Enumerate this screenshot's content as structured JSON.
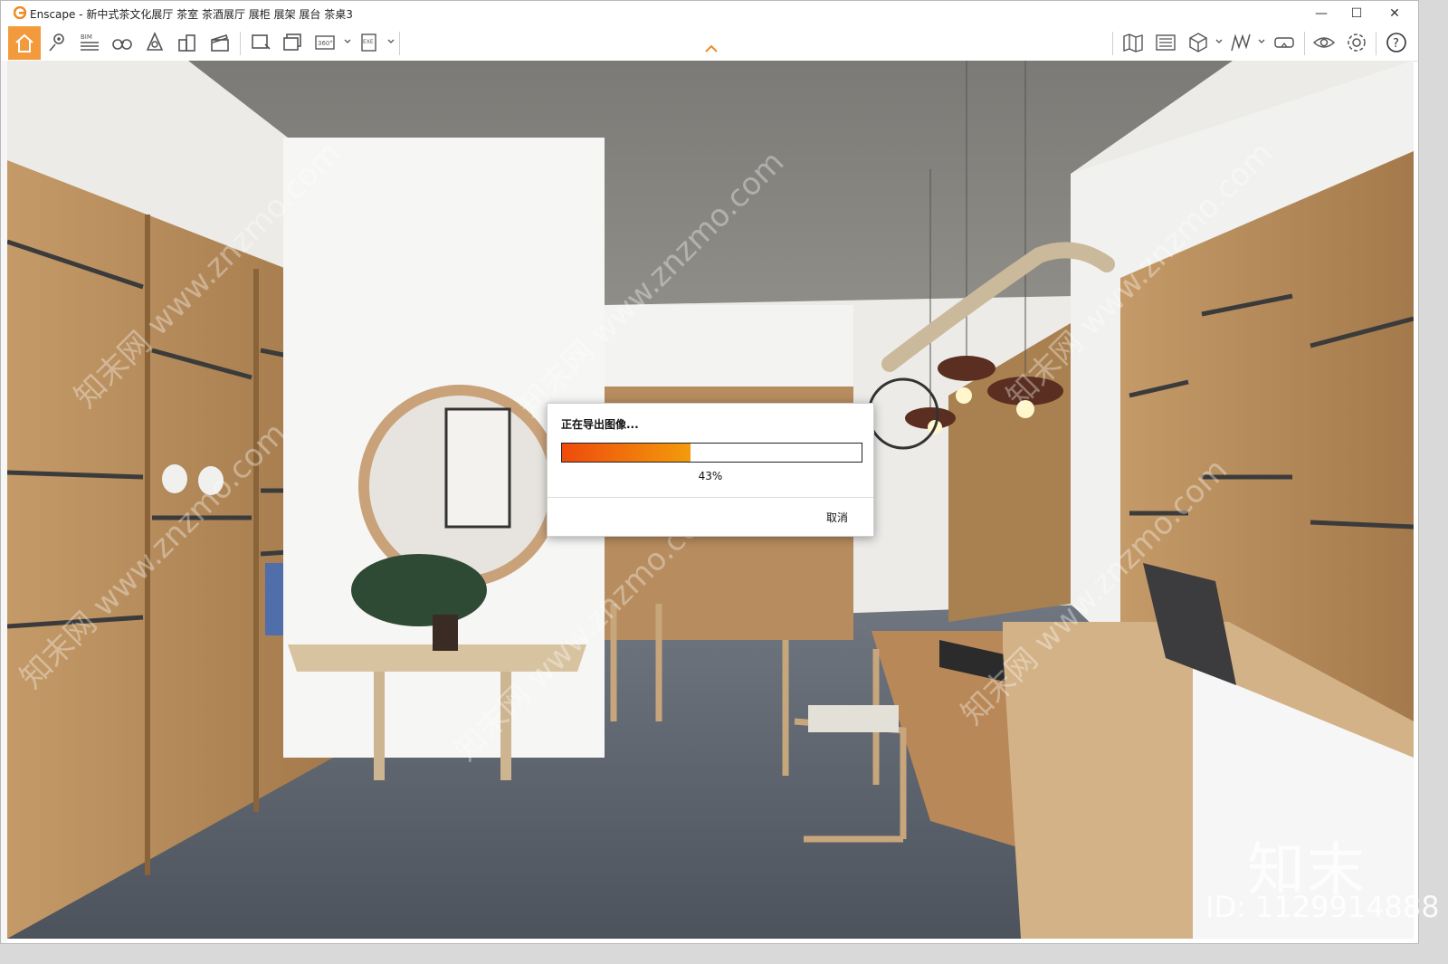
{
  "window": {
    "title": "Enscape - 新中式茶文化展厅 茶室 茶酒展厅 展柜 展架 展台 茶桌3",
    "controls": {
      "minimize": "—",
      "maximize": "☐",
      "close": "✕"
    }
  },
  "toolbar": {
    "left_icons": [
      "home-icon",
      "location-pin-icon",
      "bim-icon",
      "binoculars-icon",
      "asset-library-icon",
      "buildings-icon",
      "video-editor-icon",
      "screenshot-icon",
      "batch-render-icon",
      "panorama-360-icon",
      "export-exe-icon"
    ],
    "right_icons": [
      "map-view-icon",
      "render-preview-icon",
      "cube-view-icon",
      "visual-settings-icon",
      "vr-headset-icon",
      "eye-icon",
      "settings-icon",
      "help-icon"
    ],
    "bim_label": "BIM",
    "pano_label": "360°",
    "exe_label": "EXE",
    "help_label": "?"
  },
  "dialog": {
    "title": "正在导出图像...",
    "progress_fraction": 0.43,
    "progress_text": "43%",
    "cancel_label": "取消"
  },
  "watermark": {
    "logo_text": "知末",
    "id_text": "ID: 1129914888",
    "diagonal_text": "知末网 www.znzmo.com"
  },
  "colors": {
    "accent": "#f39a3d",
    "progress_start": "#ee4b0c",
    "progress_end": "#f39b0c"
  }
}
